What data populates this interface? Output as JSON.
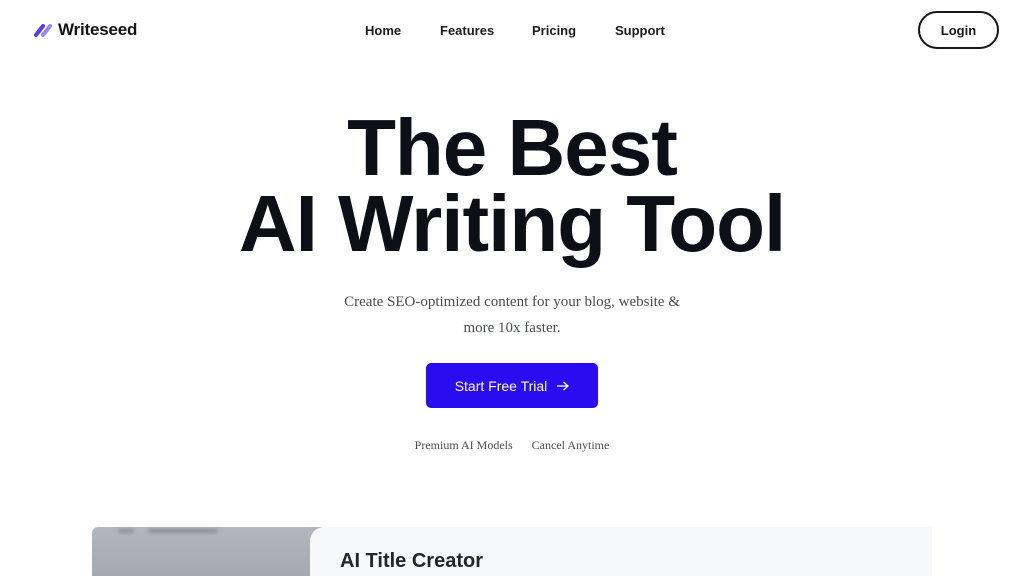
{
  "brand": {
    "name": "Writeseed",
    "logo_icon": "double-slash-logo-icon",
    "accent_color": "#2a0cf0"
  },
  "nav": {
    "items": [
      {
        "label": "Home"
      },
      {
        "label": "Features"
      },
      {
        "label": "Pricing"
      },
      {
        "label": "Support"
      }
    ],
    "login_label": "Login"
  },
  "hero": {
    "title_line1": "The Best",
    "title_line2": "AI Writing Tool",
    "subtitle_line1": "Create SEO-optimized content for your blog, website &",
    "subtitle_line2": "more 10x faster.",
    "cta_label": "Start Free Trial",
    "cta_icon": "arrow-right-icon",
    "features": [
      "Premium AI Models",
      "Cancel Anytime"
    ]
  },
  "preview": {
    "title": "AI Title Creator"
  }
}
